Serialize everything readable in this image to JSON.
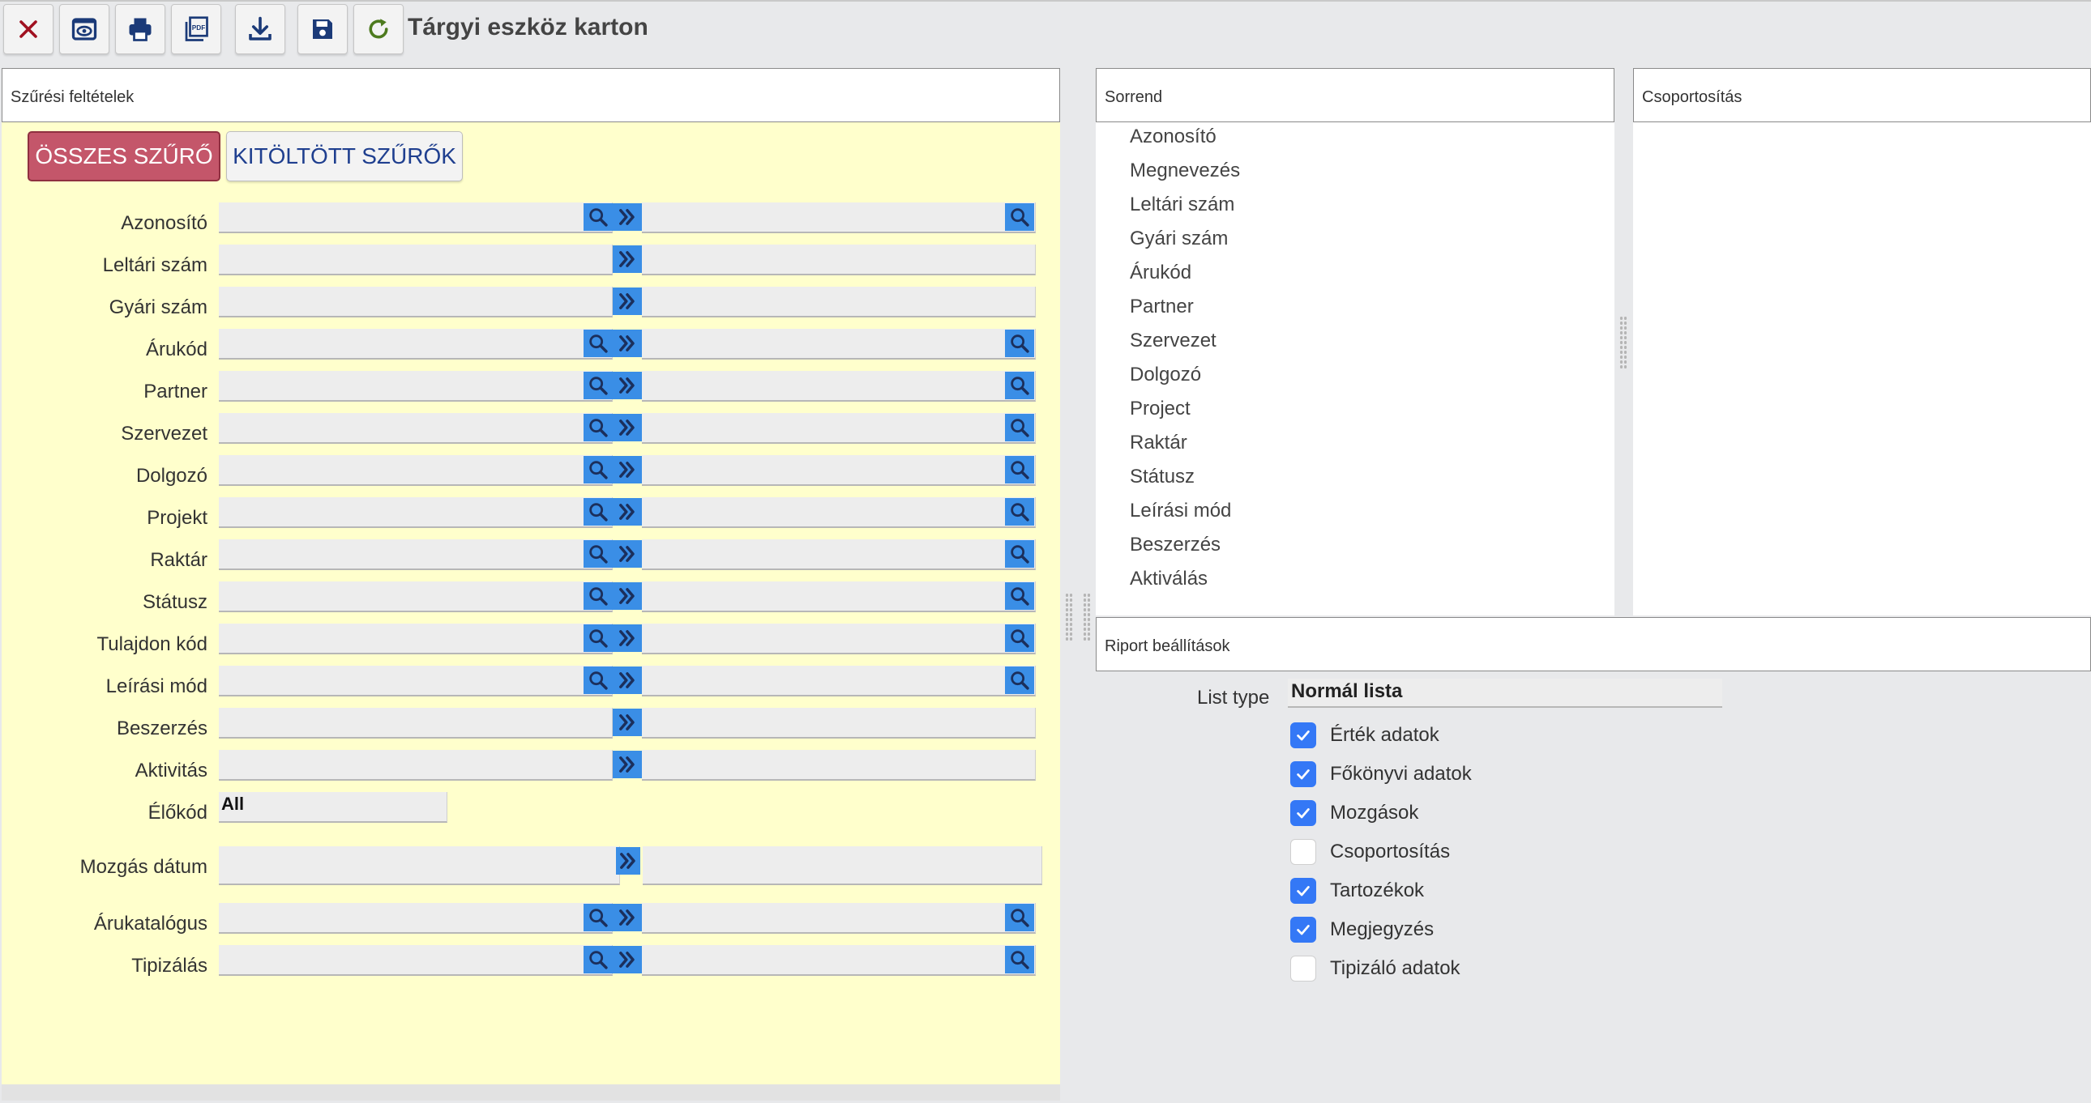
{
  "toolbar": {
    "title": "Tárgyi eszköz karton",
    "buttons": [
      {
        "icon": "close-icon"
      },
      {
        "icon": "preview-icon"
      },
      {
        "icon": "print-icon"
      },
      {
        "icon": "pdf-icon",
        "label": "PDF"
      },
      {
        "icon": "download-icon"
      },
      {
        "icon": "save-icon"
      },
      {
        "icon": "refresh-icon"
      }
    ]
  },
  "colors": {
    "filter_bg": "#ffffcc",
    "accent_blue": "#3a8ee6",
    "active_tab": "#c4566a",
    "checkbox_on": "#3478f6"
  },
  "filter": {
    "header": "Szűrési feltételek",
    "tab_all": "ÖSSZES SZŰRŐ",
    "tab_filled": "KITÖLTÖTT SZŰRŐK",
    "rows": [
      {
        "label": "Azonosító",
        "type": "range-search"
      },
      {
        "label": "Leltári szám",
        "type": "range"
      },
      {
        "label": "Gyári szám",
        "type": "range"
      },
      {
        "label": "Árukód",
        "type": "range-search"
      },
      {
        "label": "Partner",
        "type": "range-search"
      },
      {
        "label": "Szervezet",
        "type": "range-search"
      },
      {
        "label": "Dolgozó",
        "type": "range-search"
      },
      {
        "label": "Projekt",
        "type": "range-search"
      },
      {
        "label": "Raktár",
        "type": "range-search"
      },
      {
        "label": "Státusz",
        "type": "range-search"
      },
      {
        "label": "Tulajdon kód",
        "type": "range-search"
      },
      {
        "label": "Leírási mód",
        "type": "range-search"
      },
      {
        "label": "Beszerzés",
        "type": "range"
      },
      {
        "label": "Aktivitás",
        "type": "range"
      },
      {
        "label": "Élőkód",
        "type": "select",
        "value": "All"
      },
      {
        "label": "Mozgás dátum",
        "type": "date-range"
      },
      {
        "label": "Árukatalógus",
        "type": "range-search"
      },
      {
        "label": "Tipizálás",
        "type": "range-search"
      }
    ]
  },
  "sort": {
    "header": "Sorrend",
    "items": [
      "Azonosító",
      "Megnevezés",
      "Leltári szám",
      "Gyári szám",
      "Árukód",
      "Partner",
      "Szervezet",
      "Dolgozó",
      "Project",
      "Raktár",
      "Státusz",
      "Leírási mód",
      "Beszerzés",
      "Aktiválás"
    ]
  },
  "group": {
    "header": "Csoportosítás"
  },
  "report": {
    "header": "Riport beállítások",
    "list_type_label": "List type",
    "list_type_value": "Normál lista",
    "options": [
      {
        "label": "Érték adatok",
        "checked": true
      },
      {
        "label": "Főkönyvi adatok",
        "checked": true
      },
      {
        "label": "Mozgások",
        "checked": true
      },
      {
        "label": "Csoportosítás",
        "checked": false
      },
      {
        "label": "Tartozékok",
        "checked": true
      },
      {
        "label": "Megjegyzés",
        "checked": true
      },
      {
        "label": "Tipizáló adatok",
        "checked": false
      }
    ]
  }
}
